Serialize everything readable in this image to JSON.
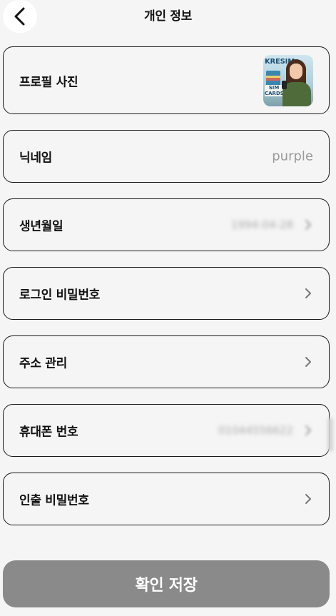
{
  "header": {
    "title": "개인 정보",
    "back_icon": "chevron-left-icon"
  },
  "rows": {
    "profile_photo": {
      "label": "프로필 사진",
      "image_brand_text": "KRESIM",
      "image_sign_text": "SIM CARDS"
    },
    "nickname": {
      "label": "닉네임",
      "value": "purple"
    },
    "birthdate": {
      "label": "생년월일",
      "value": "1994-04-28"
    },
    "login_password": {
      "label": "로그인 비밀번호"
    },
    "address": {
      "label": "주소 관리"
    },
    "phone": {
      "label": "휴대폰 번호",
      "value": "01044556622"
    },
    "withdraw_password": {
      "label": "인출 비밀번호"
    }
  },
  "footer": {
    "save_label": "확인 저장"
  },
  "colors": {
    "background": "#f5f5f5",
    "border": "#1a1a1a",
    "button": "#8a8a8a",
    "muted_text": "#9a9a9a"
  }
}
